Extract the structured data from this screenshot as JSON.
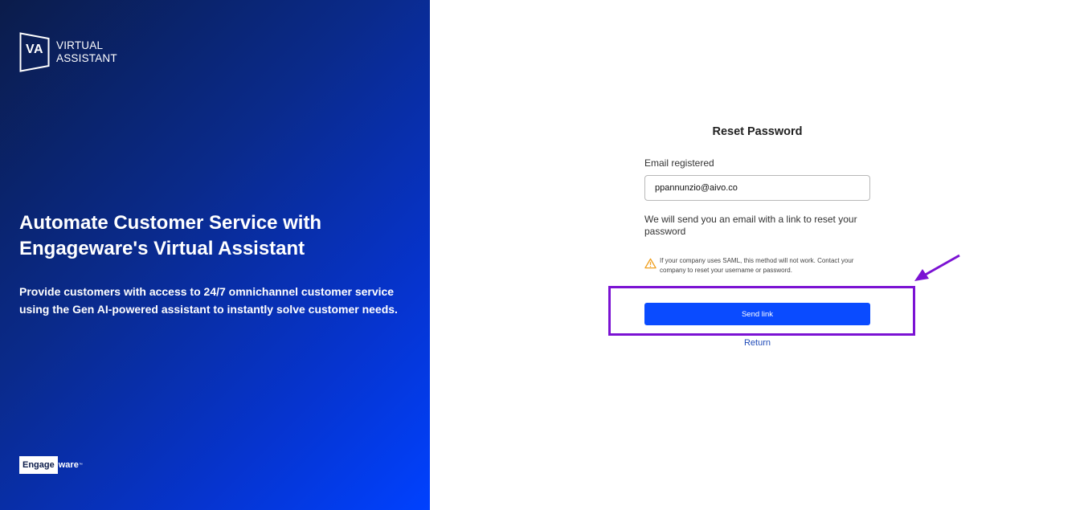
{
  "brand": {
    "mark": "VA",
    "line1": "VIRTUAL",
    "line2": "ASSISTANT"
  },
  "hero": {
    "title": "Automate Customer Service with Engageware's Virtual Assistant",
    "subtitle": "Provide customers with access to 24/7 omnichannel customer service using the Gen AI-powered assistant to instantly solve customer needs."
  },
  "footer_logo": {
    "box_text": "Engage",
    "rest_text": "ware",
    "tm": "™"
  },
  "form": {
    "title": "Reset Password",
    "email_label": "Email registered",
    "email_value": "ppannunzio@aivo.co",
    "info": "We will send you an email with a link to reset your password",
    "warning_icon": "warning-triangle-icon",
    "warning": "If your company uses SAML, this method will not work. Contact your company to reset your username or password.",
    "send_label": "Send link",
    "return_label": "Return"
  },
  "colors": {
    "accent": "#0a4bff",
    "annotation": "#7b12d3",
    "warning": "#f0a020",
    "link": "#1f4bb8"
  }
}
